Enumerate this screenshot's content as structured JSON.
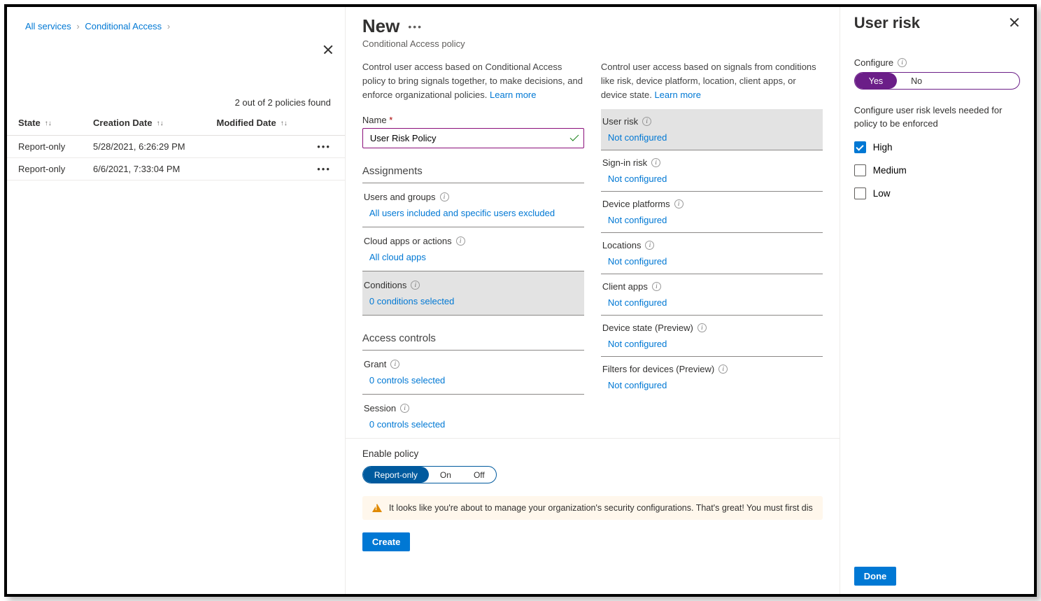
{
  "breadcrumbs": {
    "root": "All services",
    "current": "Conditional Access"
  },
  "leftTable": {
    "count_text": "2 out of 2 policies found",
    "columns": {
      "state": "State",
      "created": "Creation Date",
      "modified": "Modified Date"
    },
    "rows": [
      {
        "state": "Report-only",
        "created": "5/28/2021, 6:26:29 PM",
        "modified": ""
      },
      {
        "state": "Report-only",
        "created": "6/6/2021, 7:33:04 PM",
        "modified": ""
      }
    ]
  },
  "policyPage": {
    "title": "New",
    "subtitle": "Conditional Access policy",
    "descLeft": "Control user access based on Conditional Access policy to bring signals together, to make decisions, and enforce organizational policies.",
    "descLeftLink": "Learn more",
    "descRight": "Control user access based on signals from conditions like risk, device platform, location, client apps, or device state.",
    "descRightLink": "Learn more",
    "nameLabel": "Name",
    "nameValue": "User Risk Policy",
    "assignmentsTitle": "Assignments",
    "assignments": {
      "usersLabel": "Users and groups",
      "usersValue": "All users included and specific users excluded",
      "appsLabel": "Cloud apps or actions",
      "appsValue": "All cloud apps",
      "conditionsLabel": "Conditions",
      "conditionsValue": "0 conditions selected"
    },
    "accessTitle": "Access controls",
    "access": {
      "grantLabel": "Grant",
      "grantValue": "0 controls selected",
      "sessionLabel": "Session",
      "sessionValue": "0 controls selected"
    },
    "signals": {
      "userRisk": "User risk",
      "userRiskVal": "Not configured",
      "signinRisk": "Sign-in risk",
      "signinRiskVal": "Not configured",
      "devicePlatforms": "Device platforms",
      "devicePlatformsVal": "Not configured",
      "locations": "Locations",
      "locationsVal": "Not configured",
      "clientApps": "Client apps",
      "clientAppsVal": "Not configured",
      "deviceState": "Device state (Preview)",
      "deviceStateVal": "Not configured",
      "filters": "Filters for devices (Preview)",
      "filtersVal": "Not configured"
    },
    "enableLabel": "Enable policy",
    "enable": {
      "reportOnly": "Report-only",
      "on": "On",
      "off": "Off"
    },
    "warning": "It looks like you're about to manage your organization's security configurations. That's great! You must first dis",
    "createLabel": "Create"
  },
  "rightPanel": {
    "title": "User risk",
    "configureLabel": "Configure",
    "yesLabel": "Yes",
    "noLabel": "No",
    "help": "Configure user risk levels needed for policy to be enforced",
    "risk": {
      "high": "High",
      "medium": "Medium",
      "low": "Low"
    },
    "doneLabel": "Done",
    "state": {
      "highChecked": true,
      "mediumChecked": false,
      "lowChecked": false
    }
  }
}
